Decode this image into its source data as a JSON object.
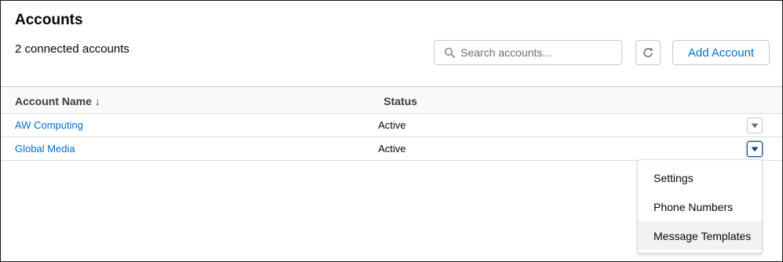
{
  "header": {
    "title": "Accounts",
    "subtitle": "2 connected accounts"
  },
  "search": {
    "placeholder": "Search accounts...",
    "value": "",
    "icon": "search-icon"
  },
  "toolbar": {
    "refresh_icon": "refresh-icon",
    "add_label": "Add Account"
  },
  "table": {
    "columns": [
      {
        "label": "Account Name ↓",
        "sort": "descending"
      },
      {
        "label": "Status"
      }
    ],
    "rows": [
      {
        "name": "AW Computing",
        "status": "Active"
      },
      {
        "name": "Global Media",
        "status": "Active"
      }
    ]
  },
  "row_menu": {
    "items": [
      "Settings",
      "Phone Numbers",
      "Message Templates"
    ],
    "hovered_index": 2
  },
  "colors": {
    "link": "#006dcc",
    "accent": "#0070d2",
    "active_border": "#1b5297"
  }
}
